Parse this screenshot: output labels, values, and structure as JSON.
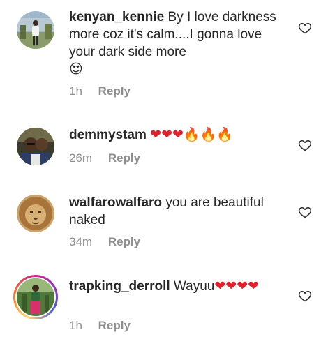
{
  "comments": [
    {
      "username": "kenyan_kennie",
      "text": " By I love darkness more coz it's calm....I gonna love your dark side more",
      "emoji": "😍",
      "time": "1h",
      "reply_label": "Reply"
    },
    {
      "username": "demmystam",
      "text": " ",
      "emoji": "❤❤❤🔥🔥🔥",
      "time": "26m",
      "reply_label": "Reply"
    },
    {
      "username": "walfarowalfaro",
      "text": " you are beautiful naked",
      "emoji": "",
      "time": "34m",
      "reply_label": "Reply"
    },
    {
      "username": "trapking_derroll",
      "text": " Wayuu",
      "emoji": "❤❤❤❤",
      "time": "1h",
      "reply_label": "Reply"
    }
  ],
  "icons": {
    "like": "heart-outline-icon",
    "story_ring": "gradient-ring"
  },
  "colors": {
    "text": "#262626",
    "meta": "#8e8e8e",
    "heart_emoji": "#e0202a"
  }
}
